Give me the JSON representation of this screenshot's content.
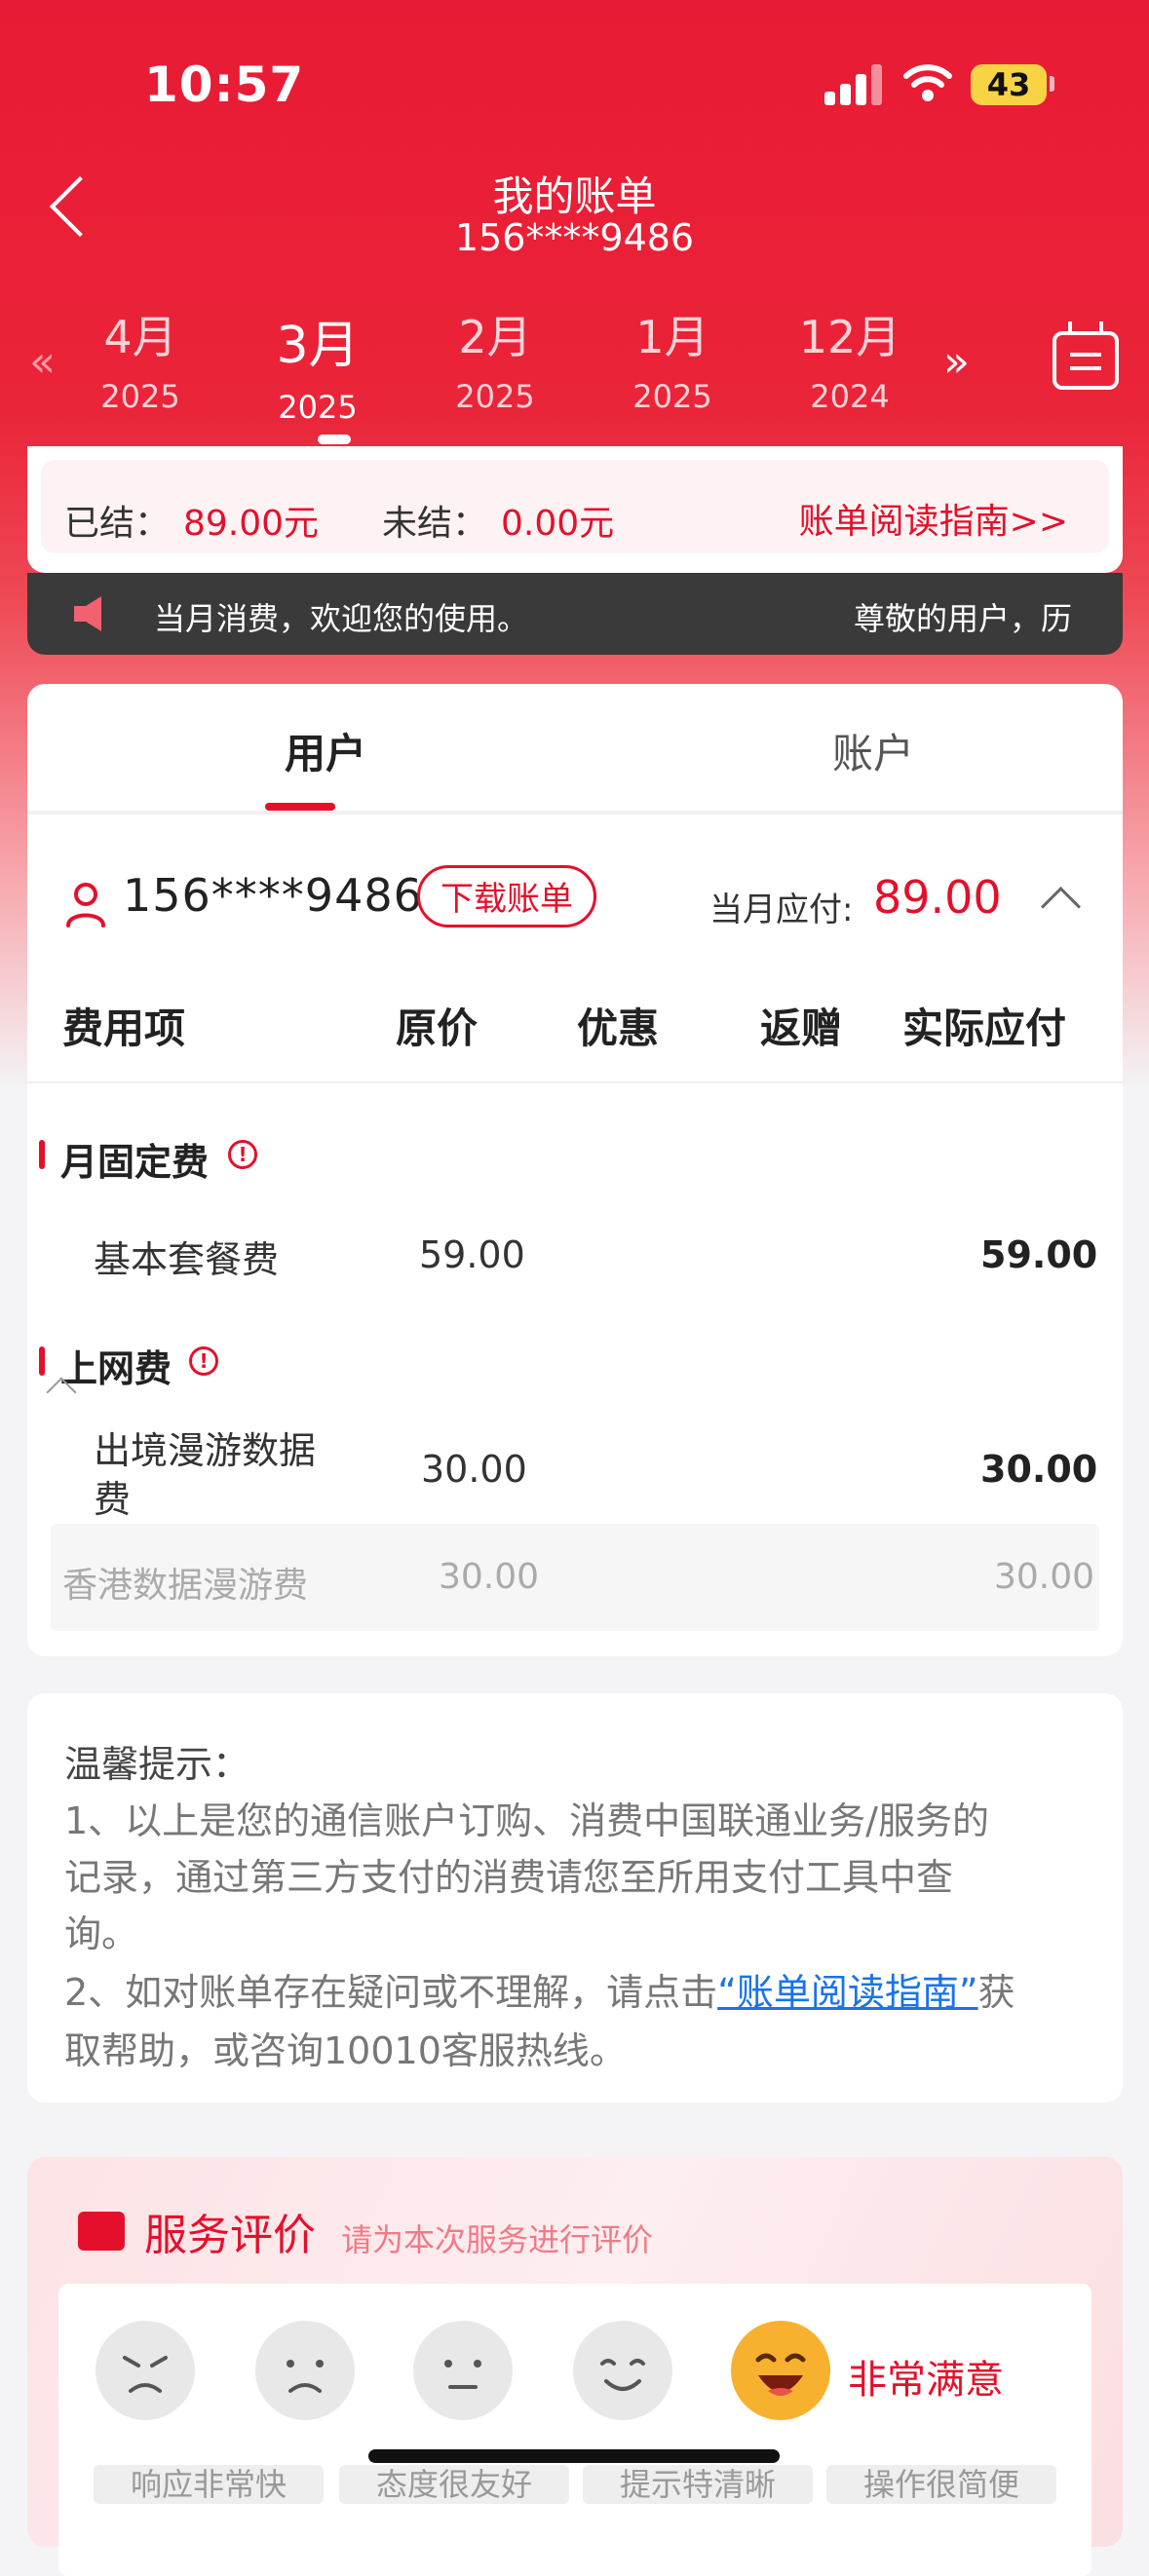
{
  "status_bar": {
    "time": "10:57",
    "battery": "43"
  },
  "header": {
    "title": "我的账单",
    "subtitle": "156****9486"
  },
  "months": [
    {
      "month": "4月",
      "year": "2025"
    },
    {
      "month": "3月",
      "year": "2025"
    },
    {
      "month": "2月",
      "year": "2025"
    },
    {
      "month": "1月",
      "year": "2025"
    },
    {
      "month": "12月",
      "year": "2024"
    }
  ],
  "month_nav": {
    "prev": "«",
    "next": "»"
  },
  "summary": {
    "settled_label": "已结：",
    "settled_value": "89.00元",
    "unsettled_label": "未结：",
    "unsettled_value": "0.00元",
    "guide_link": "账单阅读指南>>"
  },
  "notice": {
    "text_1": "当月消费，欢迎您的使用。",
    "text_2": "尊敬的用户，历"
  },
  "tabs": {
    "user": "用户",
    "account": "账户"
  },
  "bill": {
    "phone": "156****9486",
    "download_label": "下载账单",
    "due_label": "当月应付:",
    "due_value": "89.00",
    "columns": [
      "费用项",
      "原价",
      "优惠",
      "返赠",
      "实际应付"
    ],
    "sections": [
      {
        "title": "月固定费",
        "rows": [
          {
            "name": "基本套餐费",
            "original": "59.00",
            "actual": "59.00"
          }
        ]
      },
      {
        "title": "上网费",
        "rows": [
          {
            "name_line1": "出境漫游数据",
            "name_line2": "费",
            "original": "30.00",
            "actual": "30.00",
            "sub": {
              "name": "香港数据漫游费",
              "original": "30.00",
              "actual": "30.00"
            }
          }
        ]
      }
    ]
  },
  "tips": {
    "title": "温馨提示：",
    "line1": "1、以上是您的通信账户订购、消费中国联通业务/服务的",
    "line2": "记录，通过第三方支付的消费请您至所用支付工具中查",
    "line3": "询。",
    "line4_pre": "2、如对账单存在疑问或不理解，请点击",
    "line4_link": "“账单阅读指南”",
    "line4_post": "获",
    "line5": "取帮助，或咨询10010客服热线。"
  },
  "rating": {
    "title": "服务评价",
    "subtitle": "请为本次服务进行评价",
    "selected_label": "非常满意",
    "chips": [
      "响应非常快",
      "态度很友好",
      "提示特清晰",
      "操作很简便"
    ]
  },
  "colors": {
    "brand_red": "#e4102b",
    "link_blue": "#1a73e8"
  }
}
